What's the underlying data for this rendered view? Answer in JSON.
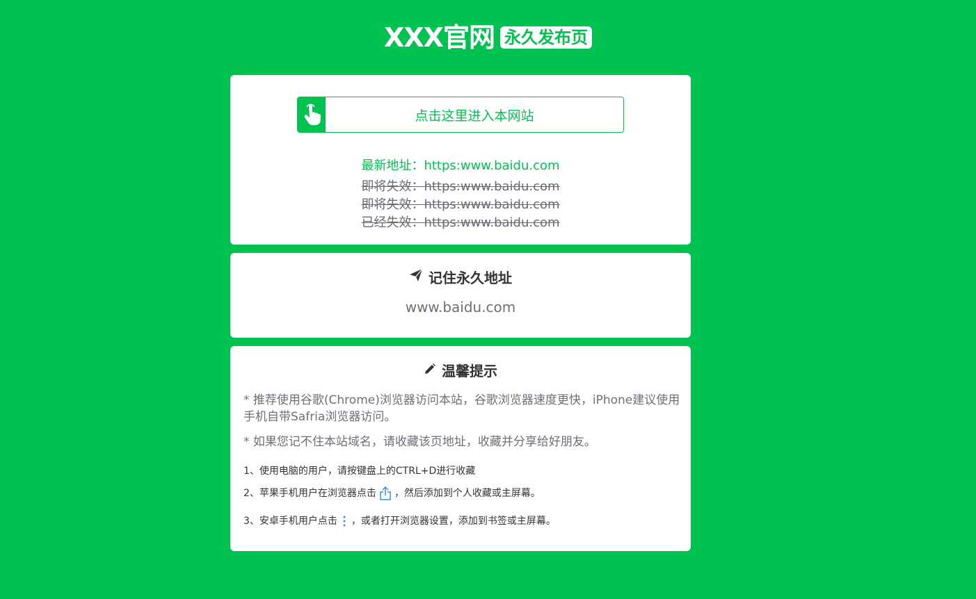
{
  "header": {
    "title": "XXX官网",
    "badge": "永久发布页"
  },
  "entry": {
    "button_label": "点击这里进入本网站",
    "button_icon": "hand-pointer-icon",
    "latest_address": "最新地址：https:www.baidu.com",
    "old_addresses": [
      "即将失效：https:www.baidu.com",
      "即将失效：https:www.baidu.com",
      "已经失效：https:www.baidu.com"
    ]
  },
  "permanent": {
    "heading": "记住永久地址",
    "heading_icon": "paper-plane-icon",
    "url": "www.baidu.com"
  },
  "tips": {
    "heading": "温馨提示",
    "heading_icon": "pencil-icon",
    "tip1": "* 推荐使用谷歌(Chrome)浏览器访问本站，谷歌浏览器速度更快，iPhone建议使用手机自带Safria浏览器访问。",
    "tip2": "* 如果您记不住本站域名，请收藏该页地址，收藏并分享给好朋友。",
    "step1": "1、使用电脑的用户，请按键盘上的CTRL+D进行收藏",
    "step2_before": "2、苹果手机用户在浏览器点击",
    "step2_after": "，然后添加到个人收藏或主屏幕。",
    "step2_icon": "share-icon",
    "step3_before": "3、安卓手机用户点击",
    "step3_after": "，或者打开浏览器设置，添加到书签或主屏幕。",
    "step3_icon": "more-vertical-icon"
  },
  "colors": {
    "brand": "#00c250",
    "card": "#ffffff",
    "muted_text": "#6b6f78",
    "icon_blue": "#3a8ee6"
  }
}
